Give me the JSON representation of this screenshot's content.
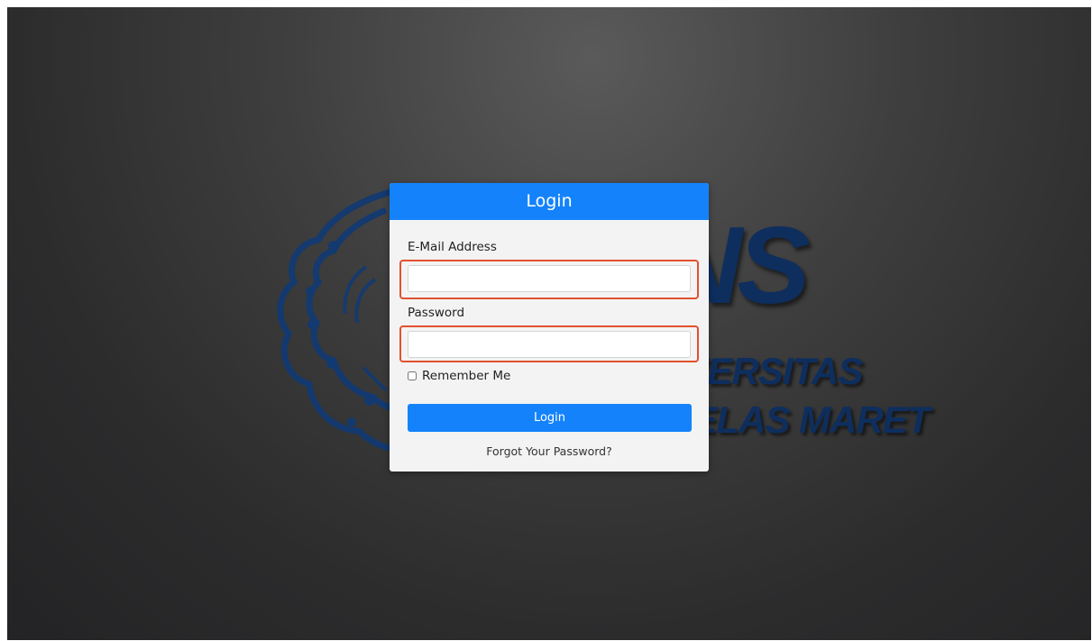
{
  "background": {
    "logo_text": "UNS",
    "logo_line1": "UNIVERSITAS",
    "logo_line2": "SEBELAS MARET",
    "logo_color": "#0e2e5e"
  },
  "login_card": {
    "title": "Login",
    "header_color": "#1483fb",
    "email_label": "E-Mail Address",
    "email_value": "",
    "password_label": "Password",
    "password_value": "",
    "remember_label": "Remember Me",
    "remember_checked": false,
    "submit_label": "Login",
    "forgot_label": "Forgot Your Password?",
    "highlight_color": "#e2502f"
  }
}
